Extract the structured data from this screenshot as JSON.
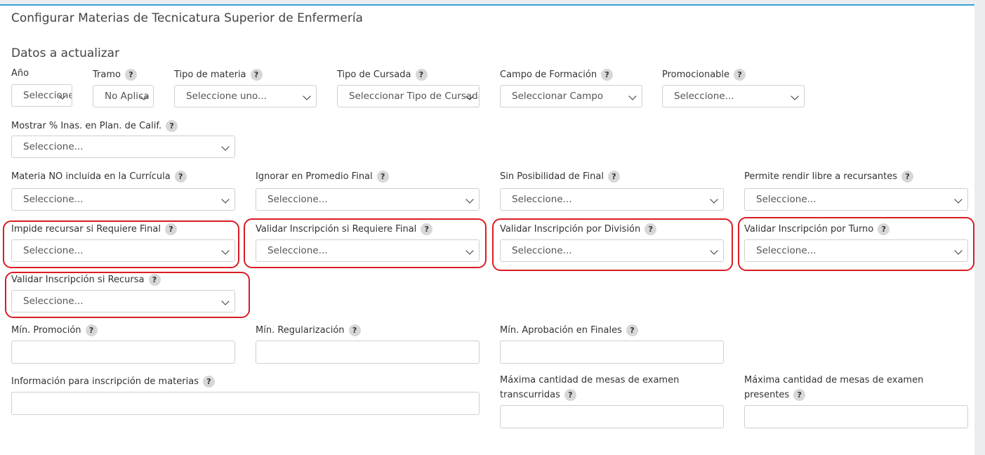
{
  "page": {
    "title": "Configurar Materias de Tecnicatura Superior de Enfermería",
    "section": "Datos a actualizar",
    "help_glyph": "?"
  },
  "row1": {
    "anio": {
      "label": "Año",
      "value": "Seleccione..."
    },
    "tramo": {
      "label": "Tramo",
      "value": "No Aplica"
    },
    "tipo_materia": {
      "label": "Tipo de materia",
      "value": "Seleccione uno..."
    },
    "tipo_cursada": {
      "label": "Tipo de Cursada",
      "value": "Seleccionar Tipo de Cursada"
    },
    "campo": {
      "label": "Campo de Formación",
      "value": "Seleccionar Campo"
    },
    "promocionable": {
      "label": "Promocionable",
      "value": "Seleccione..."
    }
  },
  "row2": {
    "mostrar_inas": {
      "label": "Mostrar % Inas. en Plan. de Calif.",
      "value": "Seleccione..."
    }
  },
  "row3": {
    "no_curricula": {
      "label": "Materia NO incluida en la Currícula",
      "value": "Seleccione..."
    },
    "ignorar_promedio": {
      "label": "Ignorar en Promedio Final",
      "value": "Seleccione..."
    },
    "sin_final": {
      "label": "Sin Posibilidad de Final",
      "value": "Seleccione..."
    },
    "rendir_libre": {
      "label": "Permite rendir libre a recursantes",
      "value": "Seleccione..."
    }
  },
  "row4": {
    "impide_recursar": {
      "label": "Impide recursar si Requiere Final",
      "value": "Seleccione..."
    },
    "validar_final": {
      "label": "Validar Inscripción si Requiere Final",
      "value": "Seleccione..."
    },
    "validar_division": {
      "label": "Validar Inscripción por División",
      "value": "Seleccione..."
    },
    "validar_turno": {
      "label": "Validar Inscripción por Turno",
      "value": "Seleccione..."
    }
  },
  "row5": {
    "validar_recursa": {
      "label": "Validar Inscripción si Recursa",
      "value": "Seleccione..."
    }
  },
  "row6": {
    "min_promocion": {
      "label": "Mín. Promoción",
      "value": ""
    },
    "min_regularizacion": {
      "label": "Mín. Regularización",
      "value": ""
    },
    "min_aprobacion": {
      "label": "Mín. Aprobación en Finales",
      "value": ""
    }
  },
  "row7": {
    "info_inscripcion": {
      "label": "Información para inscripción de materias",
      "value": ""
    },
    "max_mesas_transcurridas": {
      "label": "Máxima cantidad de mesas de examen transcurridas",
      "value": ""
    },
    "max_mesas_presentes": {
      "label": "Máxima cantidad de mesas de examen presentes",
      "value": ""
    }
  },
  "colors": {
    "highlight": "#d91c24",
    "accent_top": "#34a4d8"
  }
}
